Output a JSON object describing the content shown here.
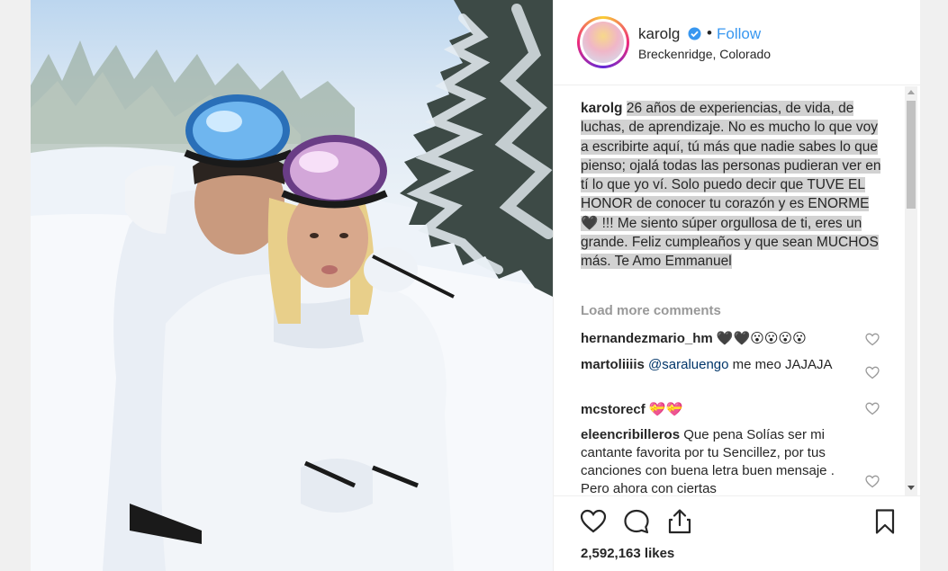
{
  "post": {
    "username": "karolg",
    "separator": "•",
    "follow_label": "Follow",
    "location": "Breckenridge, Colorado"
  },
  "caption": {
    "username": "karolg",
    "text": "26 años de experiencias, de vida, de luchas, de aprendizaje. No es mucho lo que voy a escribirte aquí, tú más que nadie sabes lo que pienso; ojalá todas las personas pudieran ver en tí lo que yo ví. Solo puedo decir que TUVE EL HONOR de conocer tu corazón y es ENORME 🖤 !!! Me siento súper orgullosa de ti, eres un grande. Feliz cumpleaños y que sean MUCHOS más. Te Amo Emmanuel"
  },
  "load_more_label": "Load more comments",
  "comments": [
    {
      "username": "hernandezmario_hm",
      "text": "🖤🖤😮😮😮😮"
    },
    {
      "username": "martoliiiis",
      "mention": "@saraluengo",
      "text": "me meo JAJAJA"
    },
    {
      "username": "mcstorecf",
      "text": "💝💝"
    },
    {
      "username": "eleencribilleros",
      "text": "Que pena Solías ser mi cantante favorita por tu Sencillez, por tus canciones con buena letra buen mensaje . Pero ahora con ciertas"
    }
  ],
  "likes_label": "2,592,163 likes",
  "icons": {
    "verified": "verified-badge-icon",
    "like": "heart-icon",
    "comment": "comment-bubble-icon",
    "share": "share-icon",
    "save": "bookmark-icon"
  },
  "colors": {
    "link_blue": "#3897f0",
    "text": "#262626",
    "muted": "#999999",
    "highlight": "#d2d2d2"
  }
}
